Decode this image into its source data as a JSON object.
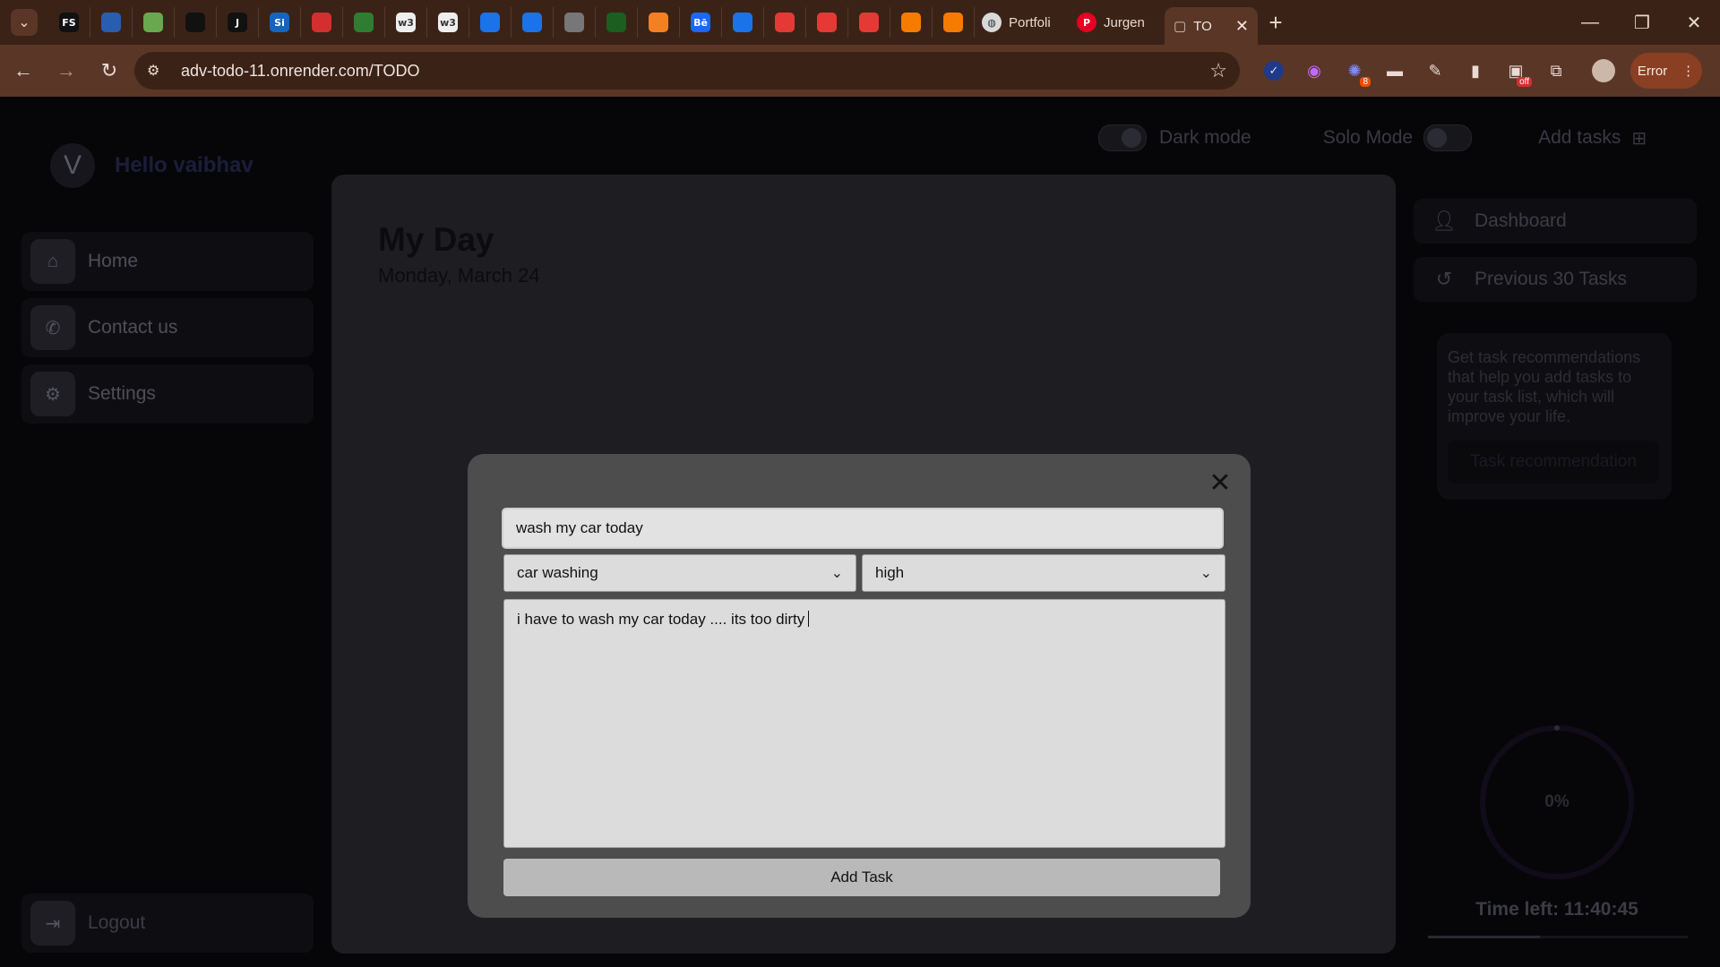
{
  "browser": {
    "tabs_pinned": [
      {
        "icon": "fs-favicon",
        "text": "FS",
        "color": "#111111"
      },
      {
        "icon": "headphone-favicon",
        "text": "",
        "color": "#2a5db0"
      },
      {
        "icon": "leetcode-favicon",
        "text": "",
        "color": "#6aa84f"
      },
      {
        "icon": "clock-favicon",
        "text": "",
        "color": "#111111"
      },
      {
        "icon": "j-favicon",
        "text": "J",
        "color": "#111111"
      },
      {
        "icon": "si-favicon",
        "text": "Si",
        "color": "#1565c0"
      },
      {
        "icon": "oracle-favicon",
        "text": "",
        "color": "#d32f2f"
      },
      {
        "icon": "gfg-favicon",
        "text": "",
        "color": "#2e7d32"
      },
      {
        "icon": "w3schools-favicon",
        "text": "w3",
        "color": "#eeeeee"
      },
      {
        "icon": "w3schools-favicon",
        "text": "w3",
        "color": "#eeeeee"
      },
      {
        "icon": "k-favicon",
        "text": "",
        "color": "#1a73e8"
      },
      {
        "icon": "k-favicon",
        "text": "",
        "color": "#1a73e8"
      },
      {
        "icon": "network-favicon",
        "text": "",
        "color": "#777777"
      },
      {
        "icon": "globe-favicon",
        "text": "",
        "color": "#1b5e20"
      },
      {
        "icon": "stack-favicon",
        "text": "",
        "color": "#f48024"
      },
      {
        "icon": "behance-favicon",
        "text": "Bē",
        "color": "#1769ff"
      },
      {
        "icon": "play-favicon",
        "text": "",
        "color": "#1a73e8"
      },
      {
        "icon": "youtube-favicon",
        "text": "",
        "color": "#e53935"
      },
      {
        "icon": "youtube-favicon",
        "text": "",
        "color": "#e53935"
      },
      {
        "icon": "youtube-favicon",
        "text": "",
        "color": "#e53935"
      },
      {
        "icon": "figure-favicon",
        "text": "",
        "color": "#f57c00"
      },
      {
        "icon": "figure-favicon",
        "text": "",
        "color": "#f57c00"
      }
    ],
    "tab_portfolio": "Portfoli",
    "tab_pinterest": "Jurgen",
    "tab_active": "TO",
    "url": "adv-todo-11.onrender.com/TODO",
    "extension_badge": "8",
    "off_badge": "off",
    "error_label": "Error"
  },
  "app": {
    "avatar_letter": "V",
    "greeting": "Hello vaibhav",
    "nav": {
      "home": "Home",
      "contact": "Contact us",
      "settings": "Settings",
      "logout": "Logout"
    },
    "top": {
      "dark_mode": "Dark mode",
      "solo_mode": "Solo Mode",
      "add_tasks": "Add tasks"
    },
    "main": {
      "title": "My Day",
      "date": "Monday, March 24"
    },
    "right": {
      "dashboard": "Dashboard",
      "previous": "Previous 30 Tasks",
      "recommend_text": "Get task recommendations that help you add tasks to your task list, which will improve your life.",
      "recommend_button": "Task recommendation",
      "progress_label": "0%",
      "progress_fraction": 0,
      "time_left": "Time left: 11:40:45",
      "time_bar_fraction": 0.43
    }
  },
  "modal": {
    "title_value": "wash my car today",
    "category_value": "car washing",
    "priority_value": "high",
    "description_value": "i have to wash my car today .... its too dirty",
    "submit_label": "Add Task"
  }
}
